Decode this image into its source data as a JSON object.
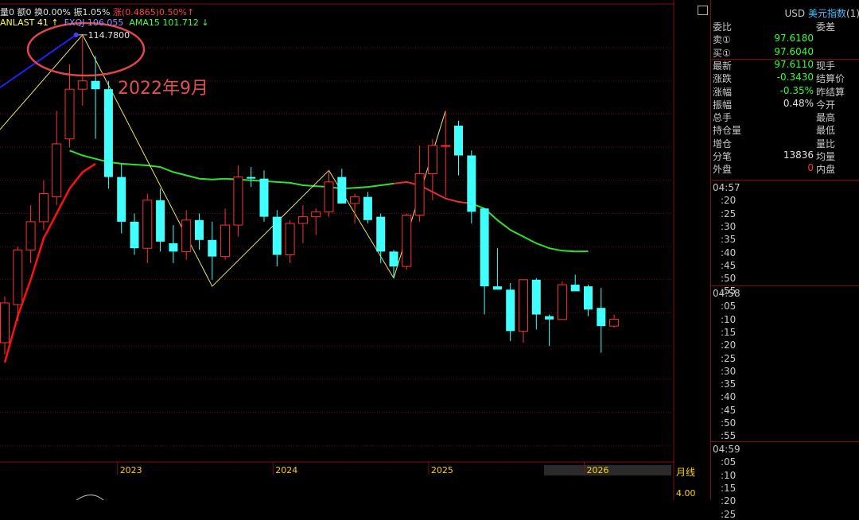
{
  "stats_line": {
    "vol": "量0",
    "amount": "额0",
    "turnover": "换0.00%",
    "amp": "振1.05%",
    "rise": "涨(0.4865)0.50%",
    "arrow": "↑"
  },
  "indicator_line": {
    "lanlast": "ANLAST 41",
    "lanlast_arrow": "↑",
    "fxqj": "FXQJ 106.055",
    "ama": "AMA15 101.712",
    "ama_arrow": "↓"
  },
  "annotations": {
    "peak_value": "114.7800",
    "peak_date": "2022年9月"
  },
  "chart_data": {
    "type": "candlestick",
    "period": "monthly",
    "ylim": [
      89,
      116.5
    ],
    "y_ticks": [
      "114.0000",
      "112.0000",
      "110.0000",
      "108.0000",
      "106.0000",
      "104.0000",
      "102.0000",
      "100.0000",
      "98.0000",
      "96.0000",
      "94.0000",
      "92.0000",
      "90.0000"
    ],
    "y_tick_values": [
      114,
      112,
      110,
      108,
      106,
      104,
      102,
      100,
      98,
      96,
      94,
      92,
      90
    ],
    "x_labels": [
      "2023",
      "2024",
      "2025",
      "2026"
    ],
    "x_label_index": [
      9,
      21,
      33,
      45
    ],
    "last_price_tag": "97.6110",
    "candles": [
      {
        "o": 96.2,
        "h": 99.0,
        "l": 95.5,
        "c": 98.6
      },
      {
        "o": 98.5,
        "h": 102.0,
        "l": 97.5,
        "c": 101.8
      },
      {
        "o": 101.8,
        "h": 104.5,
        "l": 101.0,
        "c": 103.5
      },
      {
        "o": 103.5,
        "h": 106.0,
        "l": 103.0,
        "c": 105.2
      },
      {
        "o": 105.0,
        "h": 110.2,
        "l": 104.5,
        "c": 108.2
      },
      {
        "o": 108.5,
        "h": 113.0,
        "l": 108.0,
        "c": 111.5
      },
      {
        "o": 111.5,
        "h": 114.78,
        "l": 110.5,
        "c": 112.0
      },
      {
        "o": 112.0,
        "h": 113.5,
        "l": 108.5,
        "c": 111.5
      },
      {
        "o": 111.5,
        "h": 112.0,
        "l": 105.5,
        "c": 106.2
      },
      {
        "o": 106.2,
        "h": 107.0,
        "l": 102.8,
        "c": 103.5
      },
      {
        "o": 103.5,
        "h": 104.0,
        "l": 101.5,
        "c": 101.9
      },
      {
        "o": 101.9,
        "h": 105.2,
        "l": 101.0,
        "c": 104.8
      },
      {
        "o": 104.8,
        "h": 105.5,
        "l": 101.7,
        "c": 102.3
      },
      {
        "o": 102.2,
        "h": 103.3,
        "l": 101.0,
        "c": 101.7
      },
      {
        "o": 101.7,
        "h": 104.2,
        "l": 101.2,
        "c": 103.6
      },
      {
        "o": 103.6,
        "h": 104.0,
        "l": 101.8,
        "c": 102.4
      },
      {
        "o": 102.4,
        "h": 103.5,
        "l": 100.0,
        "c": 101.4
      },
      {
        "o": 101.4,
        "h": 104.3,
        "l": 101.2,
        "c": 103.3
      },
      {
        "o": 103.3,
        "h": 106.9,
        "l": 102.6,
        "c": 106.2
      },
      {
        "o": 106.2,
        "h": 106.8,
        "l": 105.6,
        "c": 106.1
      },
      {
        "o": 106.1,
        "h": 106.6,
        "l": 103.5,
        "c": 103.8
      },
      {
        "o": 103.8,
        "h": 104.2,
        "l": 100.8,
        "c": 101.5
      },
      {
        "o": 101.5,
        "h": 103.6,
        "l": 101.0,
        "c": 103.4
      },
      {
        "o": 103.4,
        "h": 104.5,
        "l": 102.2,
        "c": 103.8
      },
      {
        "o": 103.8,
        "h": 104.3,
        "l": 102.7,
        "c": 104.1
      },
      {
        "o": 104.1,
        "h": 106.6,
        "l": 103.8,
        "c": 105.9
      },
      {
        "o": 106.2,
        "h": 106.7,
        "l": 104.6,
        "c": 104.6
      },
      {
        "o": 104.6,
        "h": 105.2,
        "l": 103.4,
        "c": 105.0
      },
      {
        "o": 105.0,
        "h": 105.3,
        "l": 103.4,
        "c": 103.6
      },
      {
        "o": 103.8,
        "h": 104.0,
        "l": 101.0,
        "c": 101.7
      },
      {
        "o": 101.7,
        "h": 101.8,
        "l": 100.1,
        "c": 100.8
      },
      {
        "o": 100.8,
        "h": 104.0,
        "l": 100.6,
        "c": 103.9
      },
      {
        "o": 103.9,
        "h": 108.1,
        "l": 103.5,
        "c": 106.4
      },
      {
        "o": 106.4,
        "h": 108.5,
        "l": 104.8,
        "c": 108.1
      },
      {
        "o": 108.1,
        "h": 110.2,
        "l": 105.0,
        "c": 108.1
      },
      {
        "o": 109.3,
        "h": 109.6,
        "l": 106.3,
        "c": 107.5
      },
      {
        "o": 107.5,
        "h": 107.8,
        "l": 103.4,
        "c": 104.1
      },
      {
        "o": 104.3,
        "h": 104.3,
        "l": 97.9,
        "c": 99.6
      },
      {
        "o": 99.6,
        "h": 101.9,
        "l": 99.4,
        "c": 99.4
      },
      {
        "o": 99.4,
        "h": 99.8,
        "l": 96.3,
        "c": 96.9
      },
      {
        "o": 96.9,
        "h": 100.0,
        "l": 96.2,
        "c": 100.0
      },
      {
        "o": 100.0,
        "h": 100.1,
        "l": 97.0,
        "c": 97.9
      },
      {
        "o": 97.8,
        "h": 97.9,
        "l": 96.0,
        "c": 97.6
      },
      {
        "o": 97.6,
        "h": 99.9,
        "l": 97.6,
        "c": 99.7
      },
      {
        "o": 99.7,
        "h": 100.3,
        "l": 99.3,
        "c": 99.3
      },
      {
        "o": 99.6,
        "h": 99.7,
        "l": 97.8,
        "c": 98.2
      },
      {
        "o": 98.3,
        "h": 99.5,
        "l": 95.6,
        "c": 97.2
      },
      {
        "o": 97.2,
        "h": 97.9,
        "l": 97.1,
        "c": 97.611
      }
    ],
    "series": [
      {
        "name": "AMA15",
        "values": [
          null,
          null,
          null,
          null,
          null,
          107.8,
          107.5,
          107.3,
          107.1,
          107.0,
          106.95,
          106.9,
          106.8,
          106.5,
          106.3,
          106.1,
          106.05,
          106.1,
          106.05,
          106.0,
          105.95,
          105.9,
          105.85,
          105.7,
          105.65,
          105.6,
          105.5,
          105.55,
          105.6,
          105.7,
          105.8,
          105.9,
          105.7,
          105.3,
          104.9,
          104.7,
          104.6,
          104.3,
          103.6,
          103.0,
          102.6,
          102.2,
          101.9,
          101.75,
          101.71,
          101.712
        ]
      },
      {
        "name": "FXQJ",
        "values": [
          95.0,
          97.8,
          100.0,
          102.5,
          104.0,
          105.5,
          106.5,
          107.0,
          null,
          null,
          null,
          null,
          null,
          null,
          null,
          null,
          null,
          null,
          null,
          null,
          null,
          null,
          null,
          null,
          null,
          null,
          null,
          null,
          null,
          null,
          null,
          null,
          null,
          null,
          null,
          null,
          null,
          null,
          null,
          null,
          null,
          null,
          null,
          null,
          null,
          null,
          null,
          null
        ]
      }
    ],
    "zigzag": [
      {
        "i": -1,
        "v": 108.5
      },
      {
        "i": 6,
        "v": 114.78
      },
      {
        "i": 16,
        "v": 99.6
      },
      {
        "i": 25,
        "v": 106.6
      },
      {
        "i": 30,
        "v": 100.1
      },
      {
        "i": 34,
        "v": 110.2
      }
    ]
  },
  "panel": {
    "title_currency": "USD",
    "title_name": "美元指数",
    "title_suffix": "(1)",
    "rows": [
      {
        "l": "委比",
        "v": "",
        "l2": "委差",
        "vc": "wht"
      },
      {
        "l": "卖①",
        "v": "97.6180",
        "l2": "",
        "vc": "grn"
      },
      {
        "l": "买①",
        "v": "97.6040",
        "l2": "",
        "vc": "grn"
      },
      {
        "l": "最新",
        "v": "97.6110",
        "l2": "现手",
        "vc": "grn",
        "lc": "yel"
      },
      {
        "l": "涨跌",
        "v": "-0.3430",
        "l2": "结算价",
        "vc": "grn"
      },
      {
        "l": "涨幅",
        "v": "-0.35%",
        "l2": "昨结算",
        "vc": "grn"
      },
      {
        "l": "振幅",
        "v": "0.48%",
        "l2": "今开",
        "vc": "wht"
      },
      {
        "l": "总手",
        "v": "",
        "l2": "最高",
        "vc": "wht"
      },
      {
        "l": "持仓量",
        "v": "",
        "l2": "最低",
        "vc": "wht"
      },
      {
        "l": "增仓",
        "v": "",
        "l2": "量比",
        "vc": "wht"
      },
      {
        "l": "分笔",
        "v": "13836",
        "l2": "均量",
        "vc": "wht"
      },
      {
        "l": "外盘",
        "v": "0",
        "l2": "内盘",
        "vc": "red"
      }
    ],
    "timeline_1": [
      "04:57",
      ":20",
      ":25",
      ":30",
      ":35",
      ":40",
      ":45",
      ":50",
      ":55"
    ],
    "timeline_2": [
      "04:58",
      ":05",
      ":10",
      ":15",
      ":20",
      ":25",
      ":30",
      ":35",
      ":40",
      ":45",
      ":50",
      ":55"
    ],
    "timeline_3": [
      "04:59",
      ":05",
      ":10",
      ":15",
      ":20",
      ":25"
    ]
  },
  "bottom": {
    "period_label": "月线",
    "volume_tick": "4.00"
  },
  "colors": {
    "up": "#ff3030",
    "down": "#40ffff",
    "ama": "#30e030",
    "fxqj_up": "#ff1010",
    "fxqj_blue": "#2020ff",
    "zigzag": "#e8e85a",
    "grid": "#5a0f0f",
    "ellipse": "#e04848"
  }
}
